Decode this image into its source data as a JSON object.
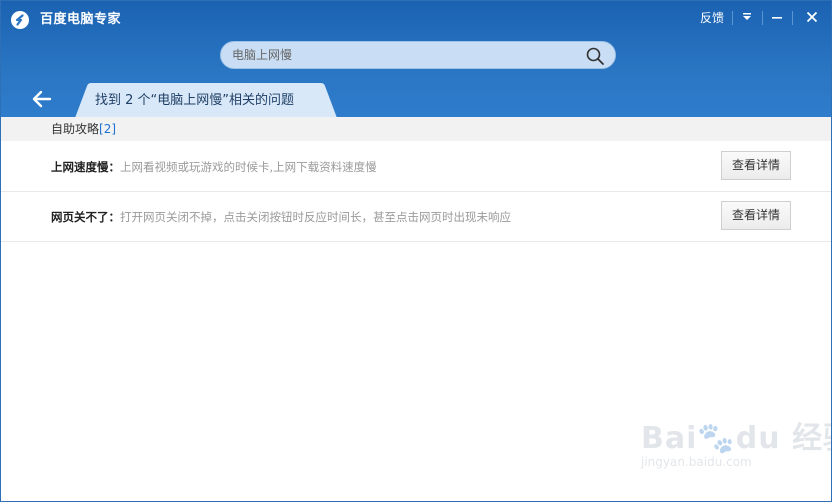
{
  "app": {
    "title": "百度电脑专家",
    "feedback_label": "反馈"
  },
  "search": {
    "value": "电脑上网慢"
  },
  "tab": {
    "label": "找到 2 个“电脑上网慢”相关的问题"
  },
  "section": {
    "label": "自助攻略",
    "count": "[2]"
  },
  "results": [
    {
      "title": "上网速度慢：",
      "desc": "上网看视频或玩游戏的时候卡,上网下载资料速度慢",
      "button": "查看详情"
    },
    {
      "title": "网页关不了：",
      "desc": "打开网页关闭不掉，点击关闭按钮时反应时间长，甚至点击网页时出现未响应",
      "button": "查看详情"
    }
  ],
  "watermark": {
    "brand": "Bai",
    "brand2": "du",
    "suffix": "经验",
    "url": "jingyan.baidu.com"
  },
  "icons": {
    "logo": "baidu-guard-logo-icon",
    "menu": "dropdown-triangle-icon",
    "minimize": "minimize-icon",
    "close": "close-icon",
    "search": "magnifier-icon",
    "back": "back-arrow-icon"
  },
  "colors": {
    "header": "#2a76c3",
    "accent": "#1e73d1"
  }
}
